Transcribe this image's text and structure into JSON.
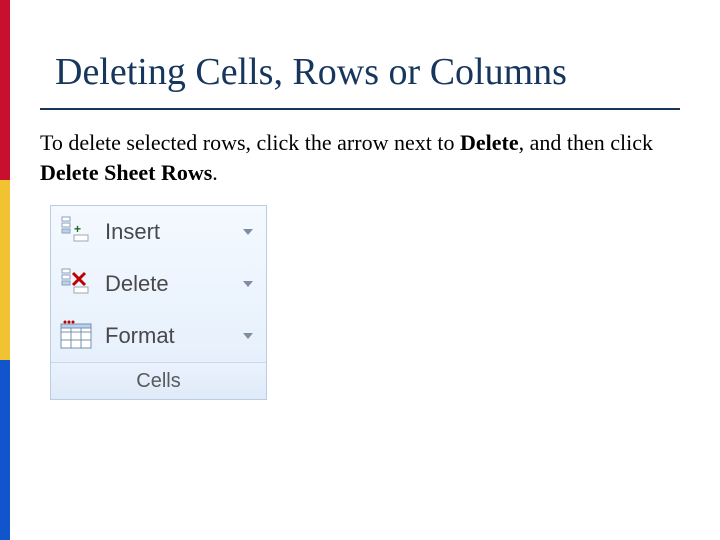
{
  "title": "Deleting Cells, Rows or Columns",
  "body": {
    "pre": "To delete selected rows, click the arrow next to ",
    "bold1": "Delete",
    "mid": ", and then click ",
    "bold2": "Delete Sheet Rows",
    "post": "."
  },
  "panel": {
    "insert": "Insert",
    "delete": "Delete",
    "format": "Format",
    "group_label": "Cells"
  },
  "colors": {
    "red": "#c8102e",
    "yellow": "#f1c232",
    "blue": "#1155cc",
    "title": "#17365d"
  }
}
